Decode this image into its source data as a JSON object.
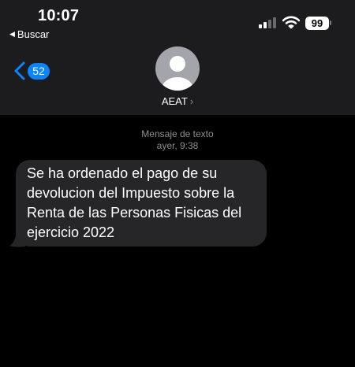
{
  "status_bar": {
    "time": "10:07",
    "back_app_label": "Buscar",
    "battery_level": "99",
    "signal_bars_active": 2,
    "signal_bars_total": 4
  },
  "nav": {
    "back_count": "52",
    "contact_name": "AEAT",
    "contact_chevron": "›"
  },
  "conversation": {
    "service_label": "Mensaje de texto",
    "timestamp": "ayer, 9:38",
    "messages": [
      {
        "direction": "incoming",
        "text": "Se ha ordenado el pago de su devolucion del Impuesto sobre la Renta de las Personas Fisicas del ejercicio 2022"
      }
    ]
  },
  "icons": {
    "back_app": "triangle-left-icon",
    "back": "chevron-left-icon",
    "avatar": "person-silhouette-icon",
    "signal": "cellular-signal-icon",
    "wifi": "wifi-icon",
    "battery": "battery-icon"
  },
  "colors": {
    "background": "#000000",
    "header": "#1c1c1e",
    "accent": "#0a84ff",
    "bubble": "#262629",
    "secondary_text": "#8e8e93",
    "avatar": "#a4a5aa"
  }
}
